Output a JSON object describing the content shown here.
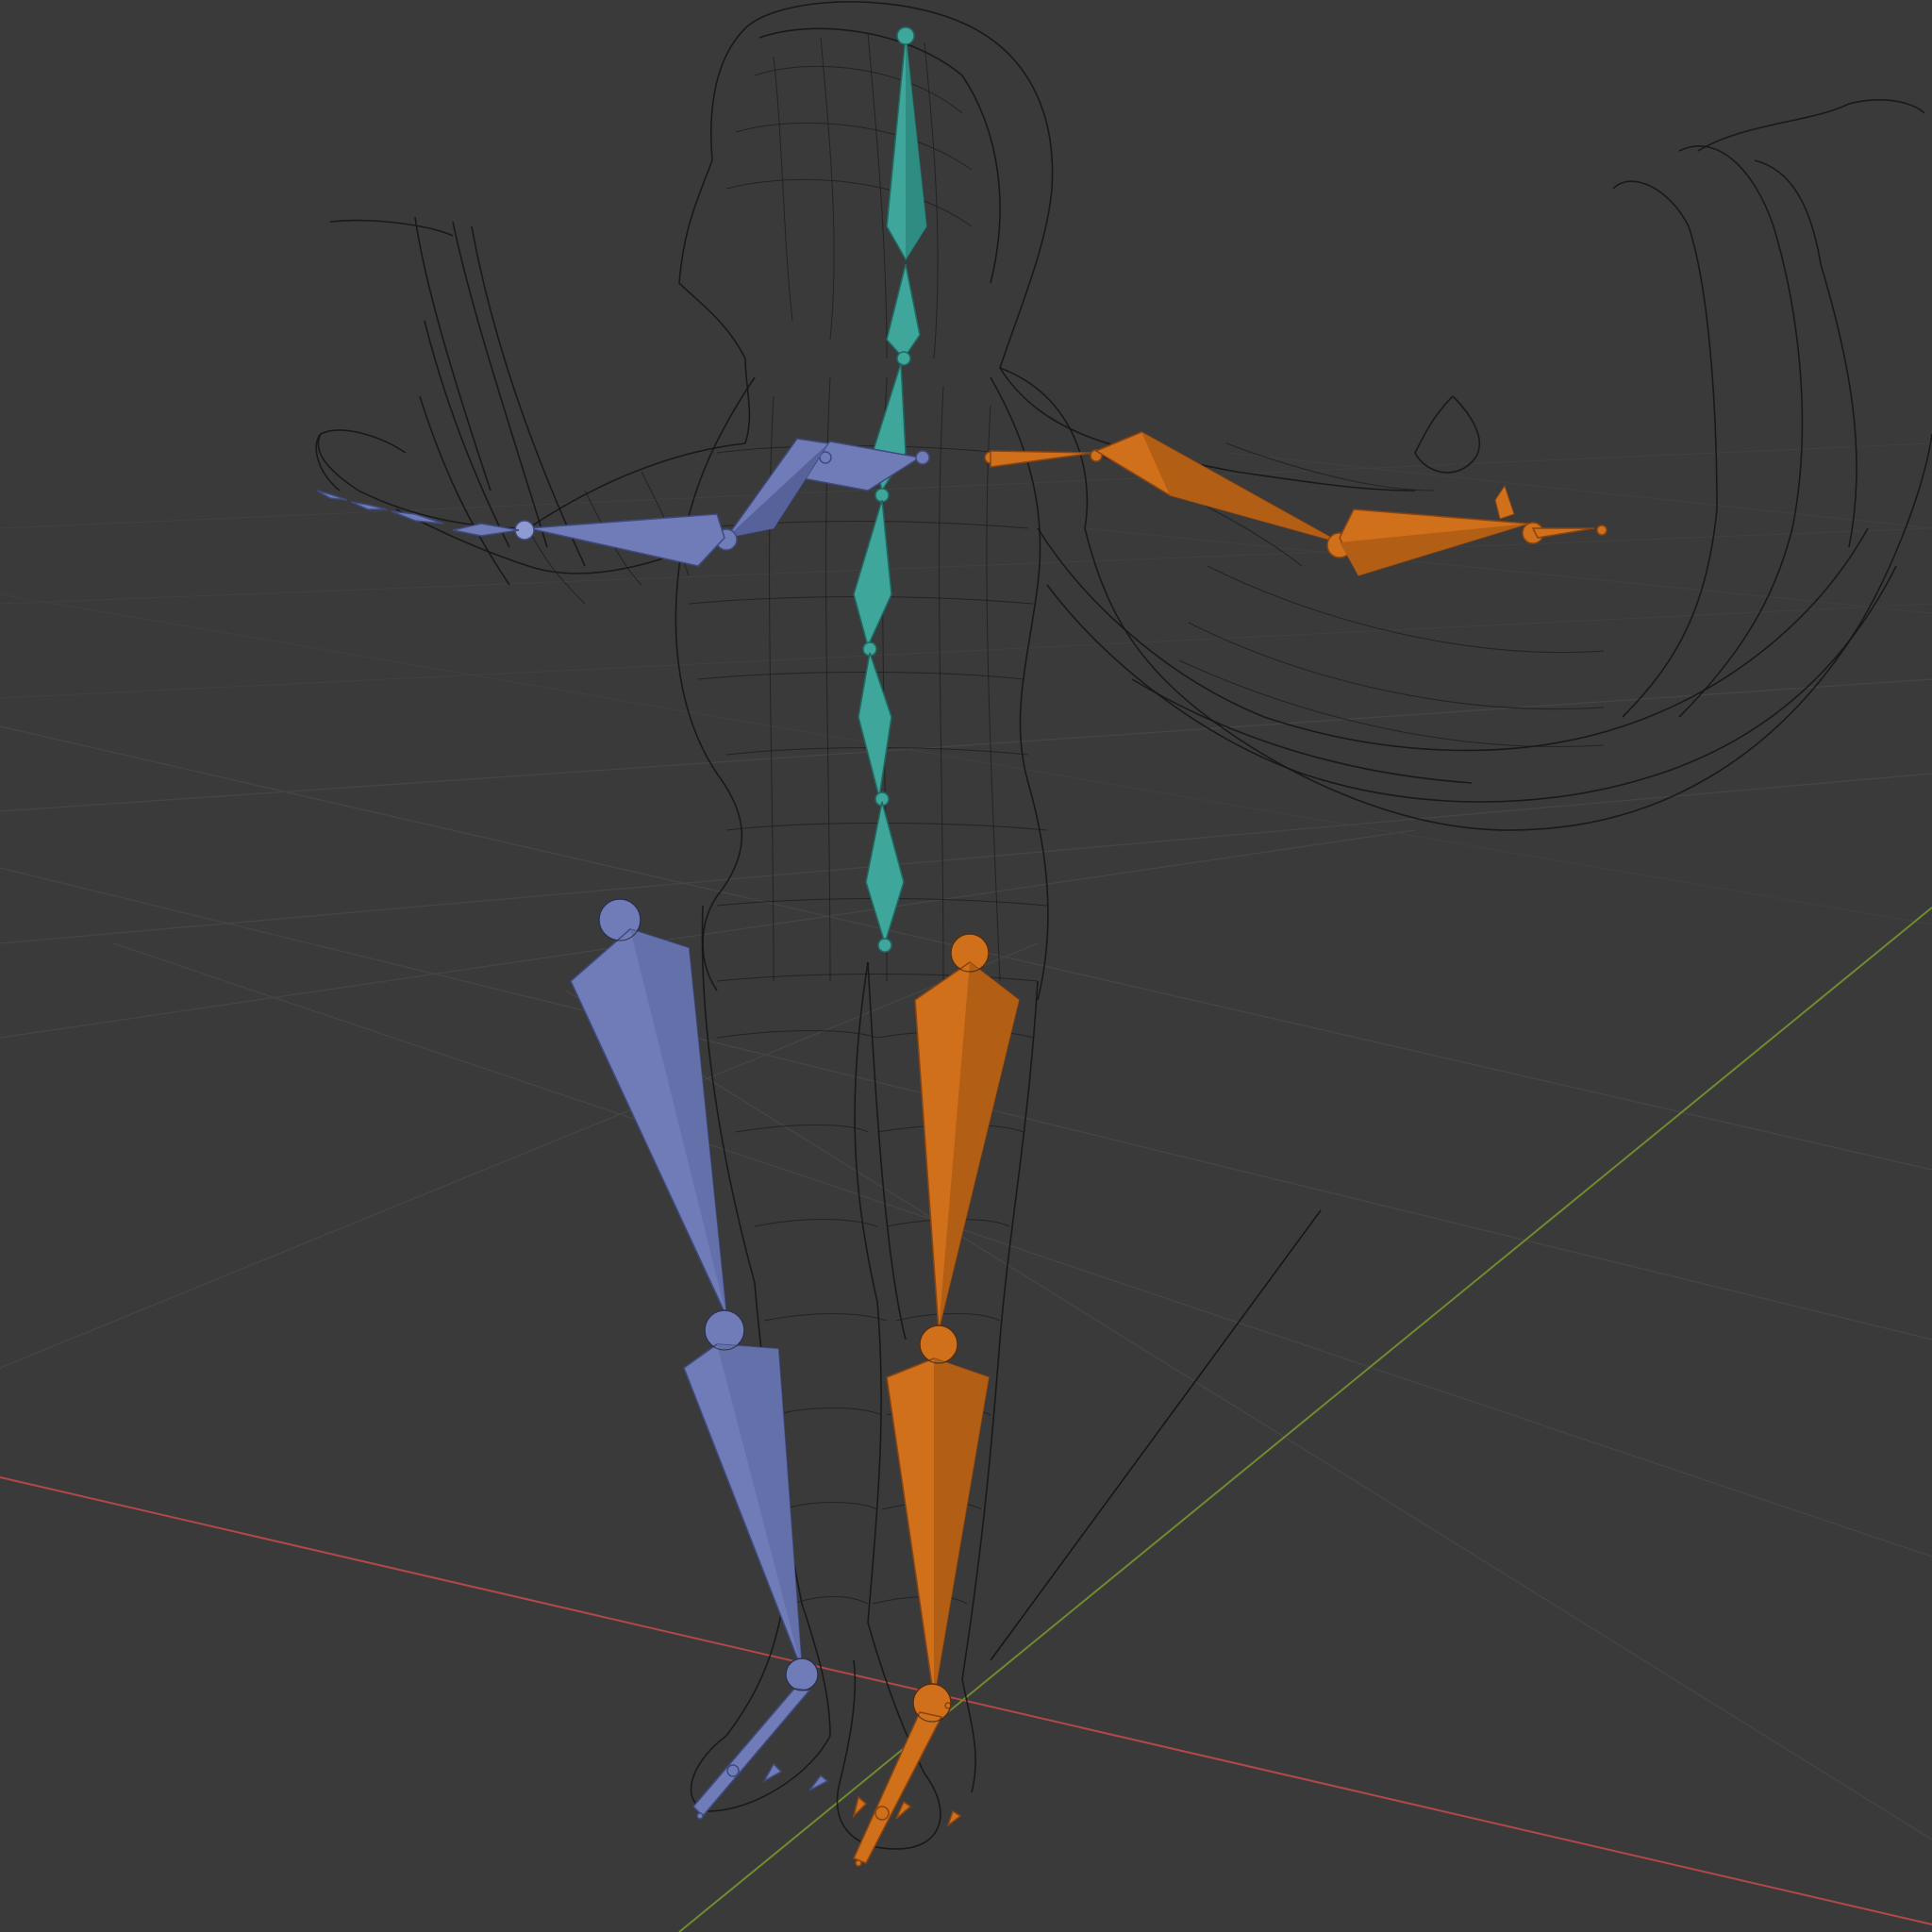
{
  "viewport": {
    "editor": "3D Viewport",
    "shading": "wireframe",
    "object": "armature"
  },
  "colors": {
    "background": "#3a3a3a",
    "grid": "#454545",
    "x_axis": "#b34848",
    "y_axis": "#6f8b2f",
    "wireframe": "#141414",
    "bone_center": "#3fa69b",
    "bone_left": "#6f7cb8",
    "bone_right": "#d1701b"
  },
  "bones": {
    "center": [
      "head",
      "neck",
      "spine_upper",
      "spine_mid",
      "spine_lower",
      "hips"
    ],
    "left": [
      "upper_arm",
      "forearm",
      "hand",
      "fingers",
      "thigh",
      "shin",
      "foot",
      "toe"
    ],
    "right": [
      "upper_arm",
      "forearm",
      "hand",
      "thigh",
      "shin",
      "foot",
      "toe"
    ]
  },
  "icons": {
    "grid": "grid-floor-icon",
    "armature": "armature-icon"
  }
}
